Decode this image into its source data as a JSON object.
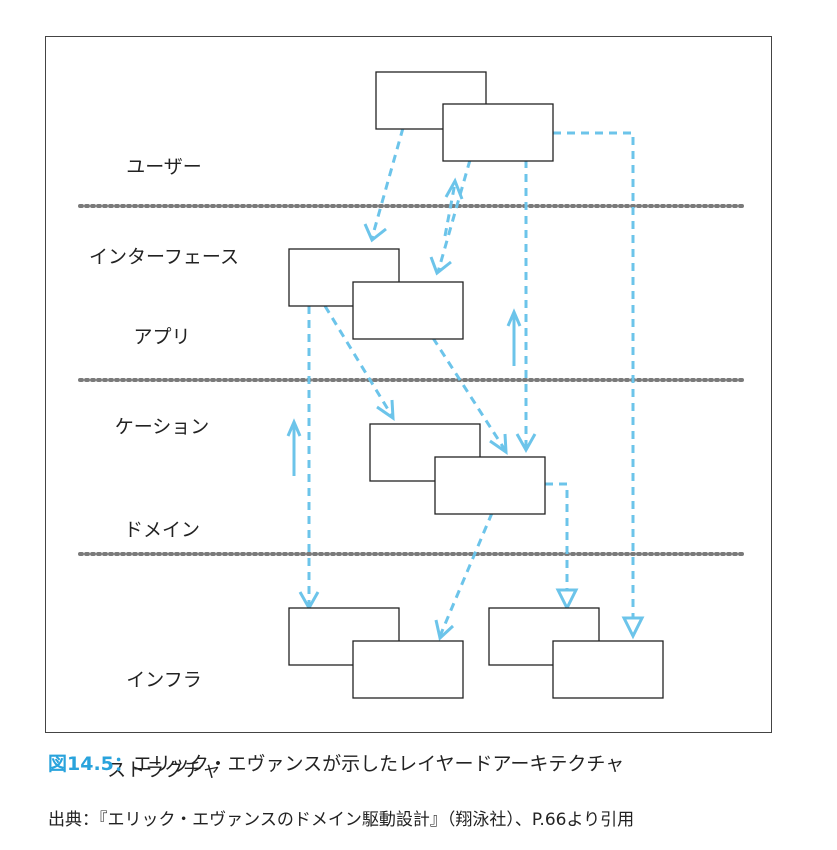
{
  "diagram": {
    "layers": [
      {
        "id": "ui",
        "line1": "ユーザー",
        "line2": "インターフェース"
      },
      {
        "id": "app",
        "line1": "アプリ",
        "line2": "ケーション"
      },
      {
        "id": "domain",
        "line1": "ドメイン",
        "line2": ""
      },
      {
        "id": "infra",
        "line1": "インフラ",
        "line2": "ストラクチャ"
      }
    ],
    "colors": {
      "arrow": "#6cc4ea",
      "separator": "#7a7a7a",
      "box_border": "#222222",
      "figure_number": "#29a3dc"
    }
  },
  "caption": {
    "number": "図14.5：",
    "text": "エリック・エヴァンスが示したレイヤードアーキテクチャ"
  },
  "source": {
    "text": "出典：『エリック・エヴァンスのドメイン駆動設計』（翔泳社）、P.66より引用"
  }
}
